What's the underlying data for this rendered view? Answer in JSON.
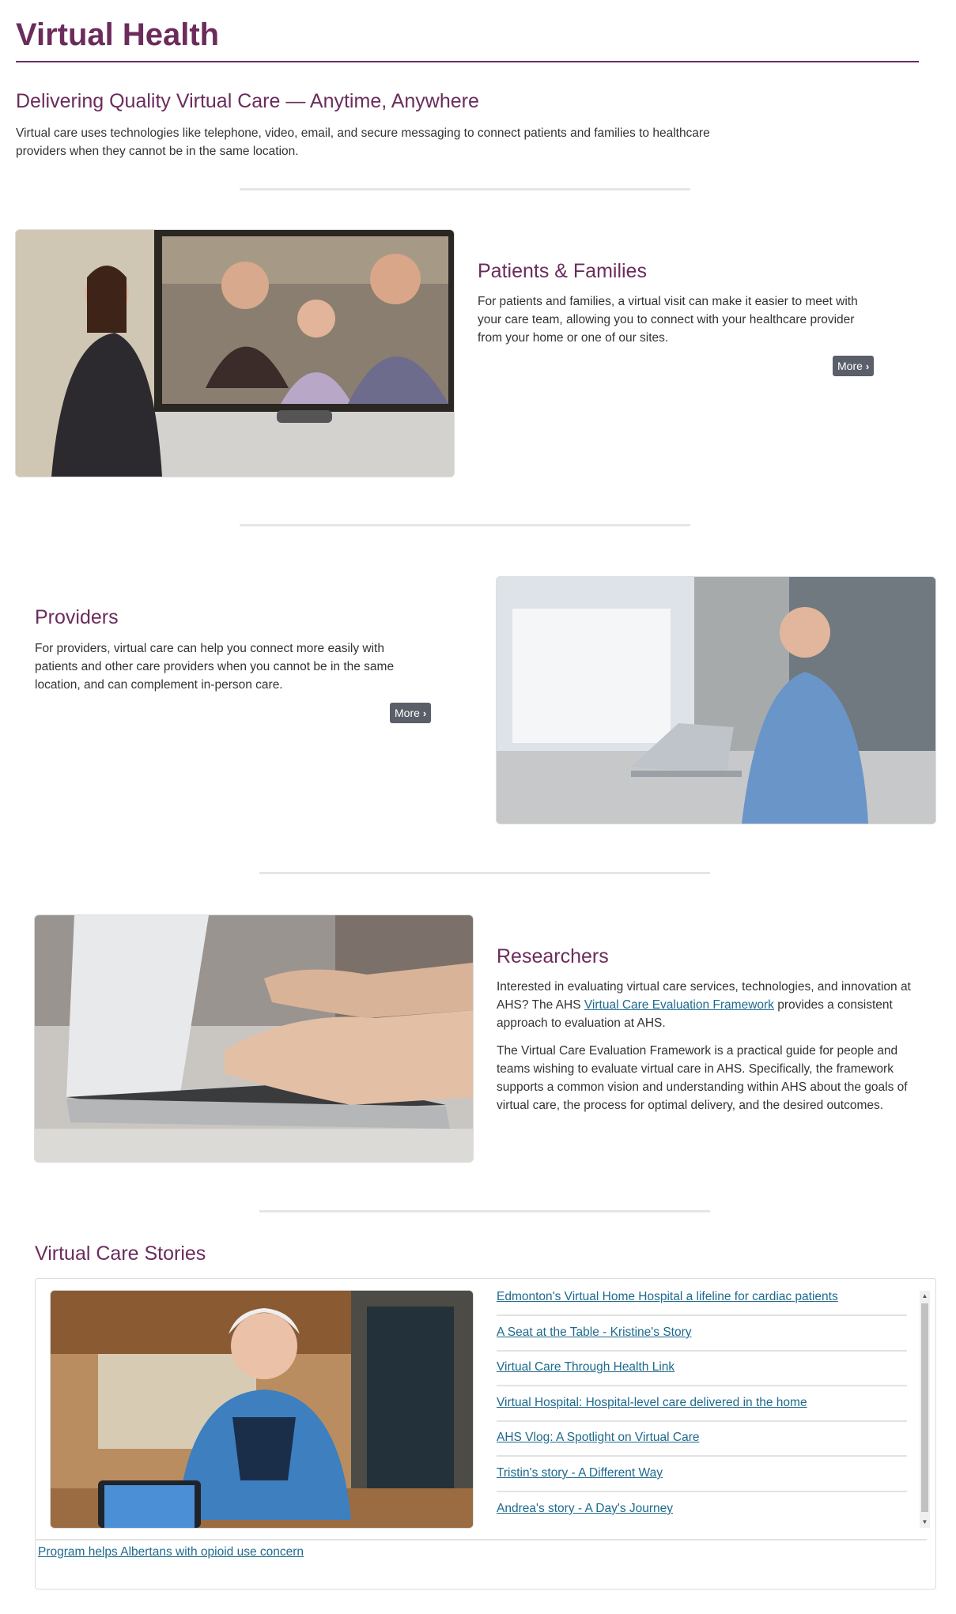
{
  "page": {
    "title": "Virtual Health"
  },
  "intro": {
    "heading": "Delivering Quality Virtual Care — Anytime, Anywhere",
    "line1": "Virtual care uses technologies like telephone, video, email, and secure messaging to connect patients and families to healthcare",
    "line2": "providers when they cannot be in the same location."
  },
  "patients": {
    "heading": "Patients & Families",
    "lines": [
      "For patients and families, a virtual visit can make it easier to meet with",
      "your care team, allowing you to connect with your healthcare provider",
      "from your home or one of our sites."
    ],
    "button": "More"
  },
  "providers": {
    "heading": "Providers",
    "lines": [
      "For providers, virtual care can help you connect more easily with",
      "patients and other care providers when you cannot be in the same",
      "location, and can complement in-person care."
    ],
    "button": "More"
  },
  "researchers": {
    "heading": "Researchers",
    "p1_line1": "Interested in evaluating virtual care services, technologies, and innovation at",
    "p1_line2_pre": "AHS? The AHS ",
    "p1_link": "Virtual Care Evaluation Framework",
    "p1_line2_post": " provides a consistent",
    "p1_line3": "approach to evaluation at AHS.",
    "p2_lines": [
      "The Virtual Care Evaluation Framework is a practical guide for people and",
      "teams wishing to evaluate virtual care in AHS. Specifically, the framework",
      "supports a common vision and understanding within AHS about the goals of",
      "virtual care, the process for optimal delivery, and the desired outcomes."
    ]
  },
  "stories": {
    "heading": "Virtual Care Stories",
    "links": [
      "Edmonton's Virtual Home Hospital a lifeline for cardiac patients",
      "A Seat at the Table - Kristine's Story",
      "Virtual Care Through Health Link",
      "Virtual Hospital: Hospital-level care delivered in the home",
      "AHS Vlog: A Spotlight on Virtual Care",
      "Tristin's story - A Different Way",
      "Andrea's story - A Day's Journey"
    ],
    "extra_link": "Program helps Albertans with opioid use concern"
  },
  "icons": {
    "more_chevron": "chevron-right-icon",
    "scroll_up": "scroll-up-arrow-icon",
    "scroll_down": "scroll-down-arrow-icon"
  },
  "colors": {
    "brand_purple": "#6b2c5c",
    "link_blue": "#1e6a8d",
    "button_gray": "#5a5f69"
  }
}
